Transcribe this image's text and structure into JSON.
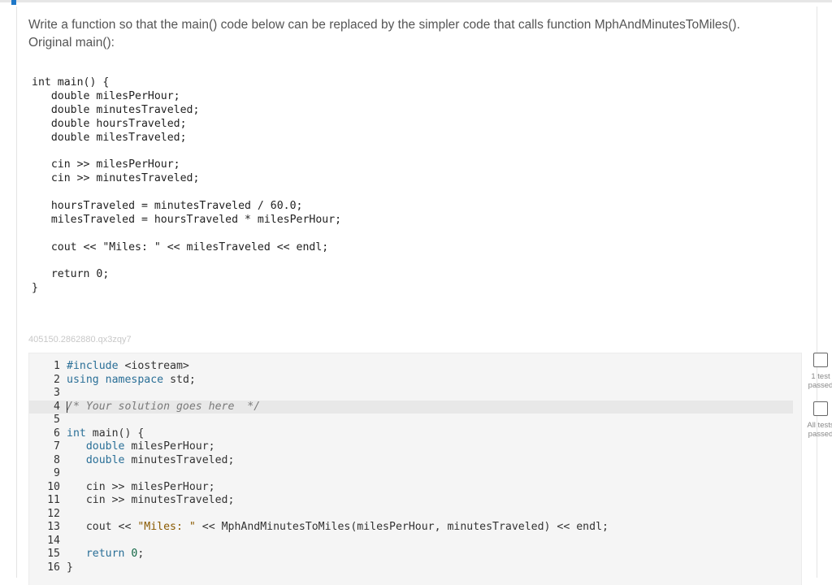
{
  "prompt": {
    "line1": "Write a function so that the main() code below can be replaced by the simpler code that calls function MphAndMinutesToMiles().",
    "line2": "Original main():"
  },
  "original_code": [
    "int main() {",
    "   double milesPerHour;",
    "   double minutesTraveled;",
    "   double hoursTraveled;",
    "   double milesTraveled;",
    "",
    "   cin >> milesPerHour;",
    "   cin >> minutesTraveled;",
    "",
    "   hoursTraveled = minutesTraveled / 60.0;",
    "   milesTraveled = hoursTraveled * milesPerHour;",
    "",
    "   cout << \"Miles: \" << milesTraveled << endl;",
    "",
    "   return 0;",
    "}"
  ],
  "problem_id": "405150.2862880.qx3zqy7",
  "editor": {
    "active_line": 4,
    "lines": [
      {
        "n": "1",
        "t": [
          [
            "kw",
            "#include"
          ],
          [
            "",
            " <iostream>"
          ]
        ]
      },
      {
        "n": "2",
        "t": [
          [
            "kw",
            "using"
          ],
          [
            "",
            " "
          ],
          [
            "kw",
            "namespace"
          ],
          [
            "",
            " std;"
          ]
        ]
      },
      {
        "n": "3",
        "t": []
      },
      {
        "n": "4",
        "t": [
          [
            "cm",
            "/* Your solution goes here  */"
          ]
        ]
      },
      {
        "n": "5",
        "t": []
      },
      {
        "n": "6",
        "t": [
          [
            "kw",
            "int"
          ],
          [
            "",
            " main() {"
          ]
        ]
      },
      {
        "n": "7",
        "t": [
          [
            "",
            "   "
          ],
          [
            "kw",
            "double"
          ],
          [
            "",
            " milesPerHour;"
          ]
        ]
      },
      {
        "n": "8",
        "t": [
          [
            "",
            "   "
          ],
          [
            "kw",
            "double"
          ],
          [
            "",
            " minutesTraveled;"
          ]
        ]
      },
      {
        "n": "9",
        "t": []
      },
      {
        "n": "10",
        "t": [
          [
            "",
            "   cin >> milesPerHour;"
          ]
        ]
      },
      {
        "n": "11",
        "t": [
          [
            "",
            "   cin >> minutesTraveled;"
          ]
        ]
      },
      {
        "n": "12",
        "t": []
      },
      {
        "n": "13",
        "t": [
          [
            "",
            "   cout << "
          ],
          [
            "str",
            "\"Miles: \""
          ],
          [
            "",
            " << MphAndMinutesToMiles(milesPerHour, minutesTraveled) << endl;"
          ]
        ]
      },
      {
        "n": "14",
        "t": []
      },
      {
        "n": "15",
        "t": [
          [
            "",
            "   "
          ],
          [
            "kw",
            "return"
          ],
          [
            "",
            " "
          ],
          [
            "num",
            "0"
          ],
          [
            "",
            ";"
          ]
        ]
      },
      {
        "n": "16",
        "t": [
          [
            "",
            "}"
          ]
        ]
      }
    ]
  },
  "tests": [
    {
      "label_line1": "1 test",
      "label_line2": "passed",
      "checked": false
    },
    {
      "label_line1": "All tests",
      "label_line2": "passed",
      "checked": false
    }
  ]
}
